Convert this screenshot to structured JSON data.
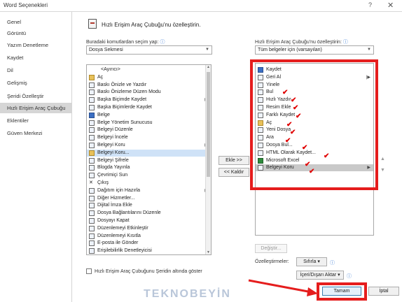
{
  "window": {
    "title": "Word Seçenekleri",
    "help": "?",
    "close": "✕"
  },
  "nav": [
    {
      "label": "Genel"
    },
    {
      "label": "Görüntü"
    },
    {
      "label": "Yazım Denetleme"
    },
    {
      "label": "Kaydet"
    },
    {
      "label": "Dil"
    },
    {
      "label": "Gelişmiş"
    },
    {
      "label": "Şeridi Özelleştir"
    },
    {
      "label": "Hızlı Erişim Araç Çubuğu"
    },
    {
      "label": "Eklentiler"
    },
    {
      "label": "Güven Merkezi"
    }
  ],
  "header": {
    "title": "Hızlı Erişim Araç Çubuğu'nu özelleştirin."
  },
  "left_panel": {
    "label": "Buradaki komutlardan seçim yap:",
    "selected": "Dosya Sekmesi",
    "commands": [
      {
        "label": "<Ayırıcı>",
        "icon": "none"
      },
      {
        "label": "Aç",
        "icon": "folder"
      },
      {
        "label": "Baskı Önizle ve Yazdır",
        "icon": "default"
      },
      {
        "label": "Baskı Önizleme Düzen Modu",
        "icon": "default"
      },
      {
        "label": "Başka Biçimde Kaydet",
        "icon": "default",
        "sub": "▶"
      },
      {
        "label": "Başka Biçimlerde Kaydet",
        "icon": "default"
      },
      {
        "label": "Belge",
        "icon": "blue"
      },
      {
        "label": "Belge Yönetim Sunucusu",
        "icon": "default"
      },
      {
        "label": "Belgeyi Düzenle",
        "icon": "default"
      },
      {
        "label": "Belgeyi İncele",
        "icon": "default"
      },
      {
        "label": "Belgeyi Koru",
        "icon": "default",
        "sub": "▶"
      },
      {
        "label": "Belgeyi Koru...",
        "icon": "folder"
      },
      {
        "label": "Belgeyi Şifrele",
        "icon": "default"
      },
      {
        "label": "Blogda Yayınla",
        "icon": "default"
      },
      {
        "label": "Çevrimiçi Sun",
        "icon": "default"
      },
      {
        "label": "Çıkış",
        "icon": "none",
        "glyph": "✕"
      },
      {
        "label": "Dağıtım için Hazırla",
        "icon": "default",
        "sub": "▶"
      },
      {
        "label": "Diğer Hizmetler...",
        "icon": "default"
      },
      {
        "label": "Dijital İmza Ekle",
        "icon": "default"
      },
      {
        "label": "Dosya Bağlantılarını Düzenle",
        "icon": "default"
      },
      {
        "label": "Dosyayı Kapat",
        "icon": "default"
      },
      {
        "label": "Düzenlemeyi Etkinleştir",
        "icon": "default"
      },
      {
        "label": "Düzenlemeyi Kısıtla",
        "icon": "default"
      },
      {
        "label": "E-posta ile Gönder",
        "icon": "default"
      },
      {
        "label": "Erişilebilirlik Denetleyicisi",
        "icon": "default"
      }
    ]
  },
  "right_panel": {
    "label": "Hızlı Erişim Araç Çubuğu'nu özelleştirin:",
    "selected": "Tüm belgeler için (varsayılan)",
    "commands": [
      {
        "label": "Kaydet",
        "icon": "blue"
      },
      {
        "label": "Geri Al",
        "icon": "default",
        "sub": "|▶"
      },
      {
        "label": "Yinele",
        "icon": "default"
      },
      {
        "label": "Bul",
        "icon": "default"
      },
      {
        "label": "Hızlı Yazdır",
        "icon": "default"
      },
      {
        "label": "Resim Ekle",
        "icon": "default"
      },
      {
        "label": "Farklı Kaydet",
        "icon": "default"
      },
      {
        "label": "Aç",
        "icon": "folder"
      },
      {
        "label": "Yeni Dosya",
        "icon": "default"
      },
      {
        "label": "Ara",
        "icon": "default"
      },
      {
        "label": "Dosya Bul...",
        "icon": "default"
      },
      {
        "label": "HTML Olarak Kaydet...",
        "icon": "default"
      },
      {
        "label": "Microsoft Excel",
        "icon": "green"
      },
      {
        "label": "Belgeyi Koru",
        "icon": "default",
        "sub": "▶"
      }
    ],
    "modify_button": "Değiştir...",
    "customizations_label": "Özelleştirmeler:",
    "reset_button": "Sıfırla ▾",
    "import_export_button": "İçeri/Dışarı Aktar ▾"
  },
  "add_button": "Ekle >>",
  "remove_button": "<< Kaldır",
  "show_below_label": "Hızlı Erişim Araç Çubuğunu Şeridin altında göster",
  "ok_button": "Tamam",
  "cancel_button": "İptal",
  "watermark": "TEKNOBEYİN",
  "highlight_color": "#e51d1d"
}
